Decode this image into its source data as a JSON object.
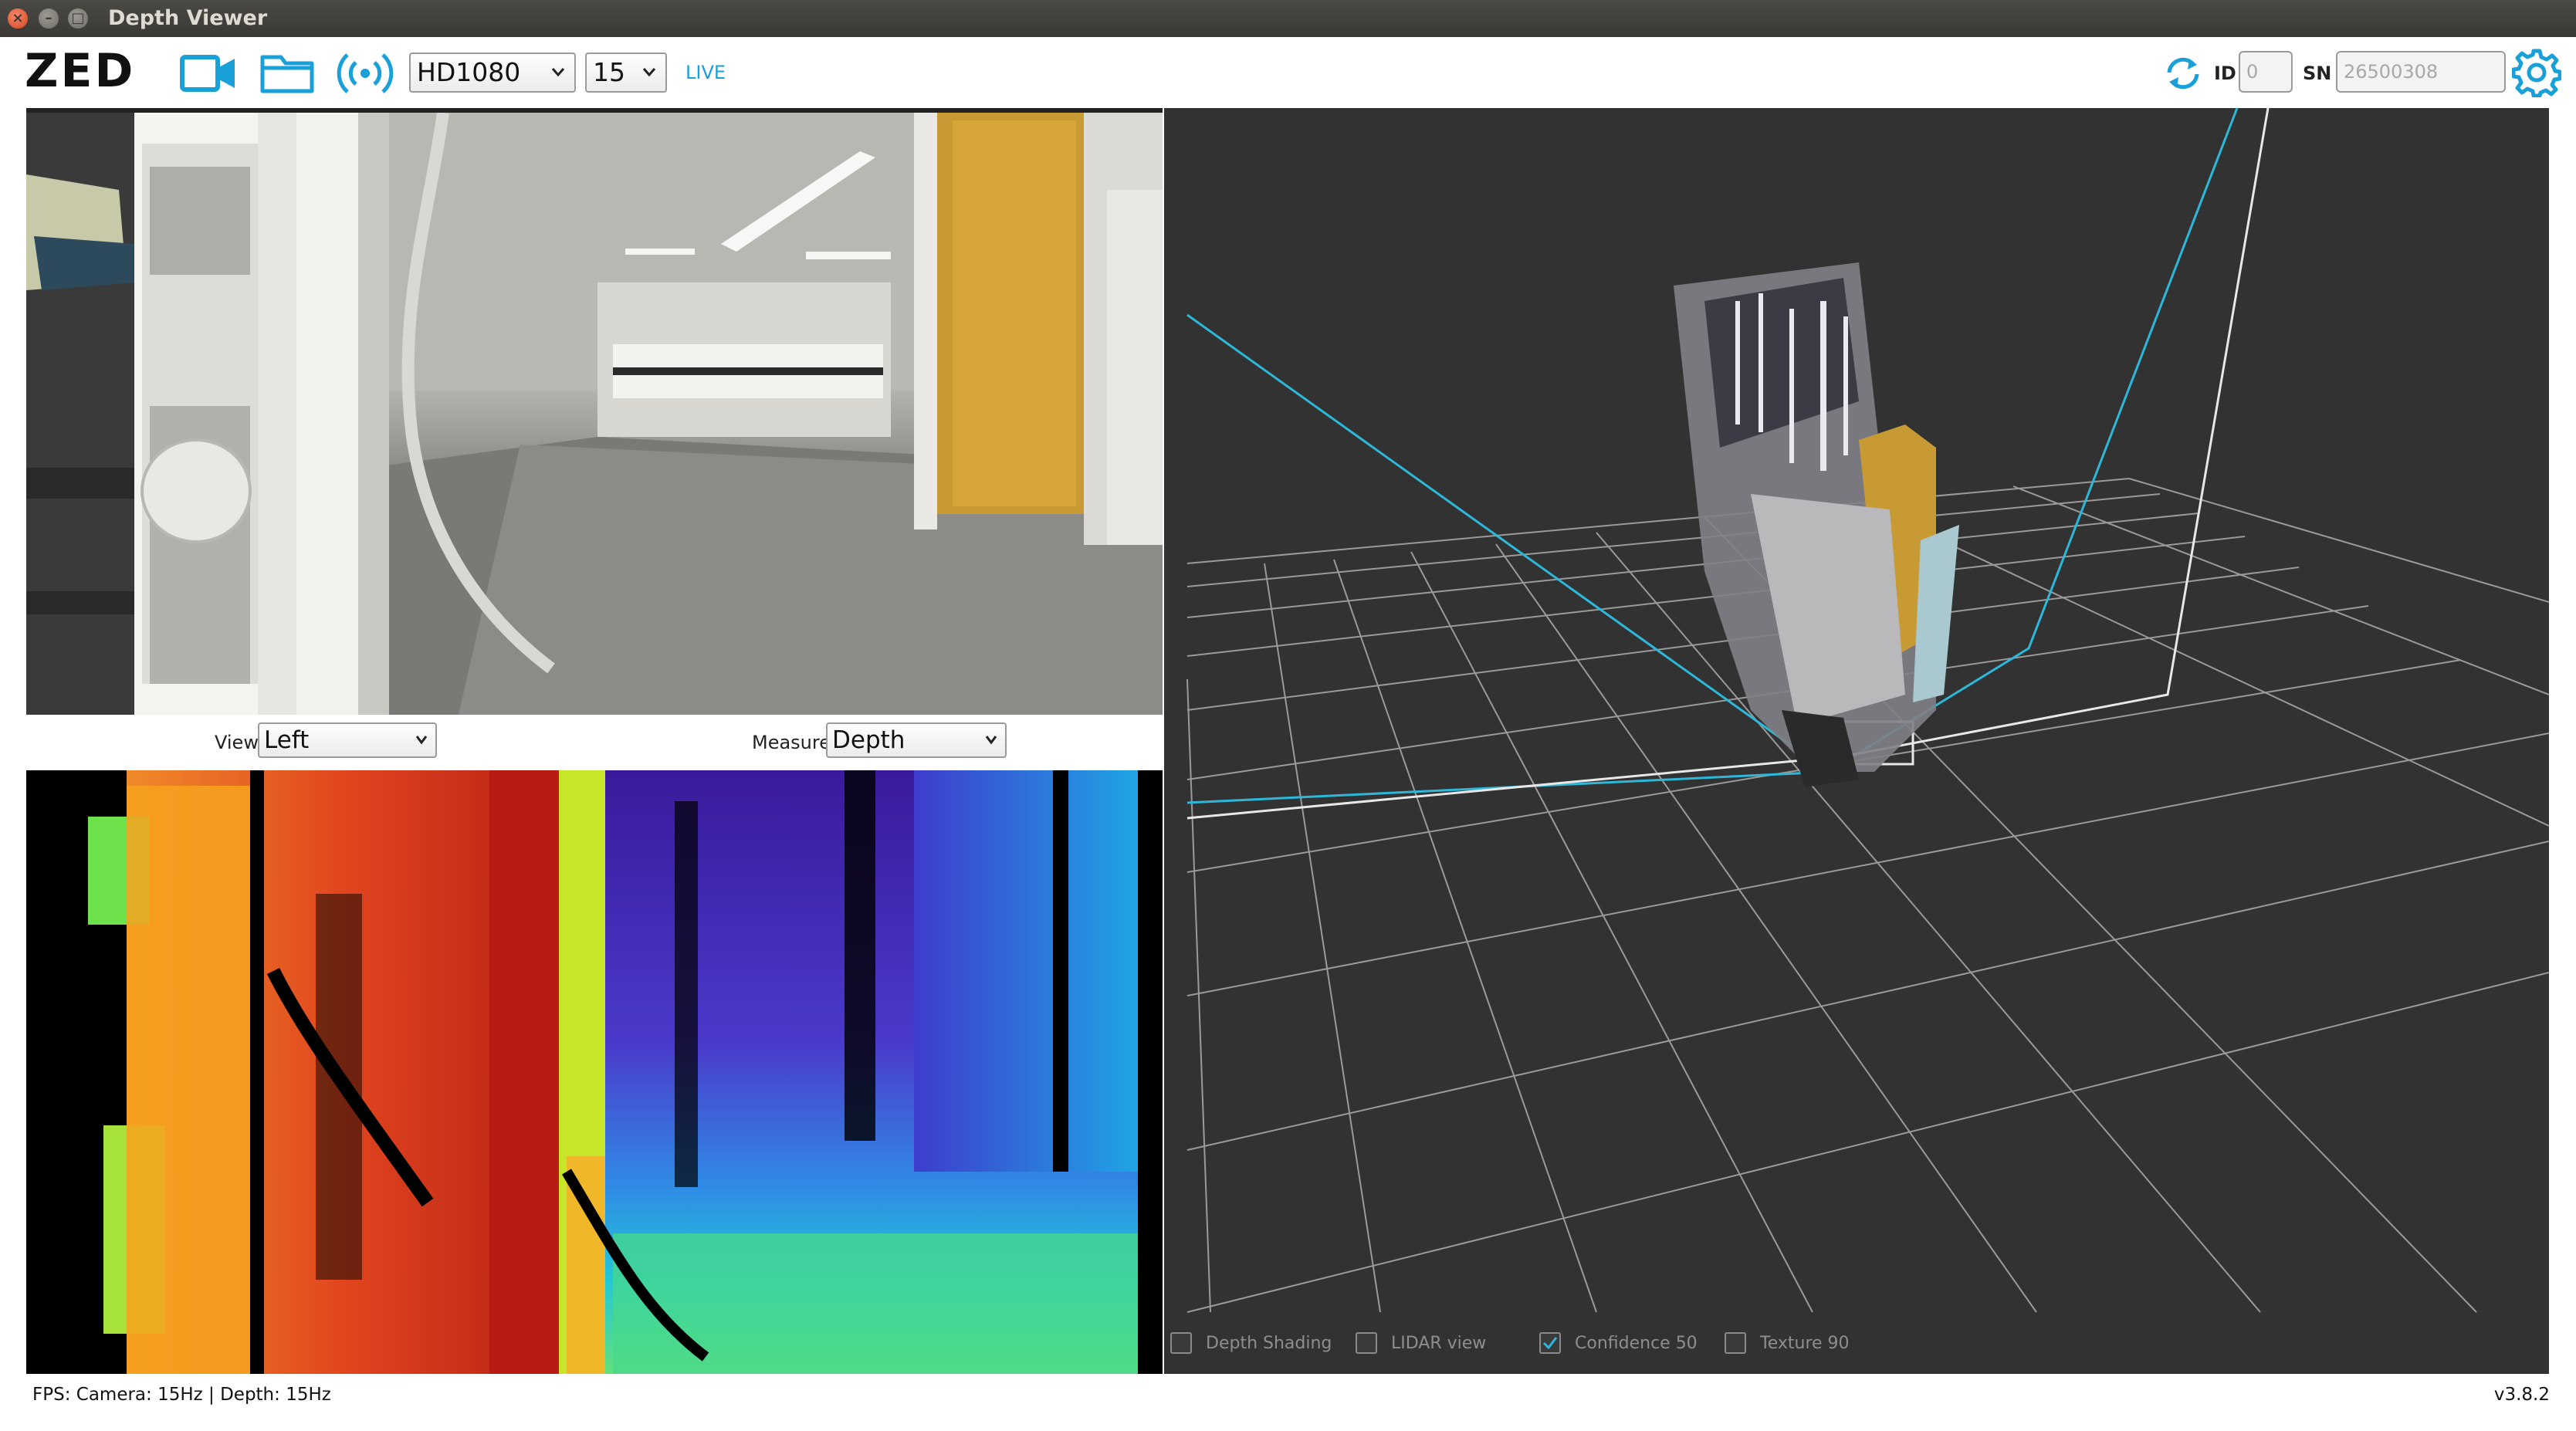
{
  "window": {
    "title": "Depth Viewer"
  },
  "toolbar": {
    "logo": "ZED",
    "resolution": "HD1080",
    "fps": "15",
    "live_label": "LIVE",
    "id_label": "ID",
    "id_value": "0",
    "sn_label": "SN",
    "sn_value": "26500308",
    "accent_color": "#1aa0d8"
  },
  "controls": {
    "view_label": "View",
    "view_value": "Left",
    "measure_label": "Measure",
    "measure_value": "Depth"
  },
  "cloud_options": [
    {
      "label": "Depth Shading",
      "checked": false
    },
    {
      "label": "LIDAR view",
      "checked": false
    },
    {
      "label": "Confidence 50",
      "checked": true
    },
    {
      "label": "Texture 90",
      "checked": false
    }
  ],
  "status": {
    "fps_text": "FPS: Camera: 15Hz | Depth: 15Hz",
    "version": "v3.8.2"
  }
}
